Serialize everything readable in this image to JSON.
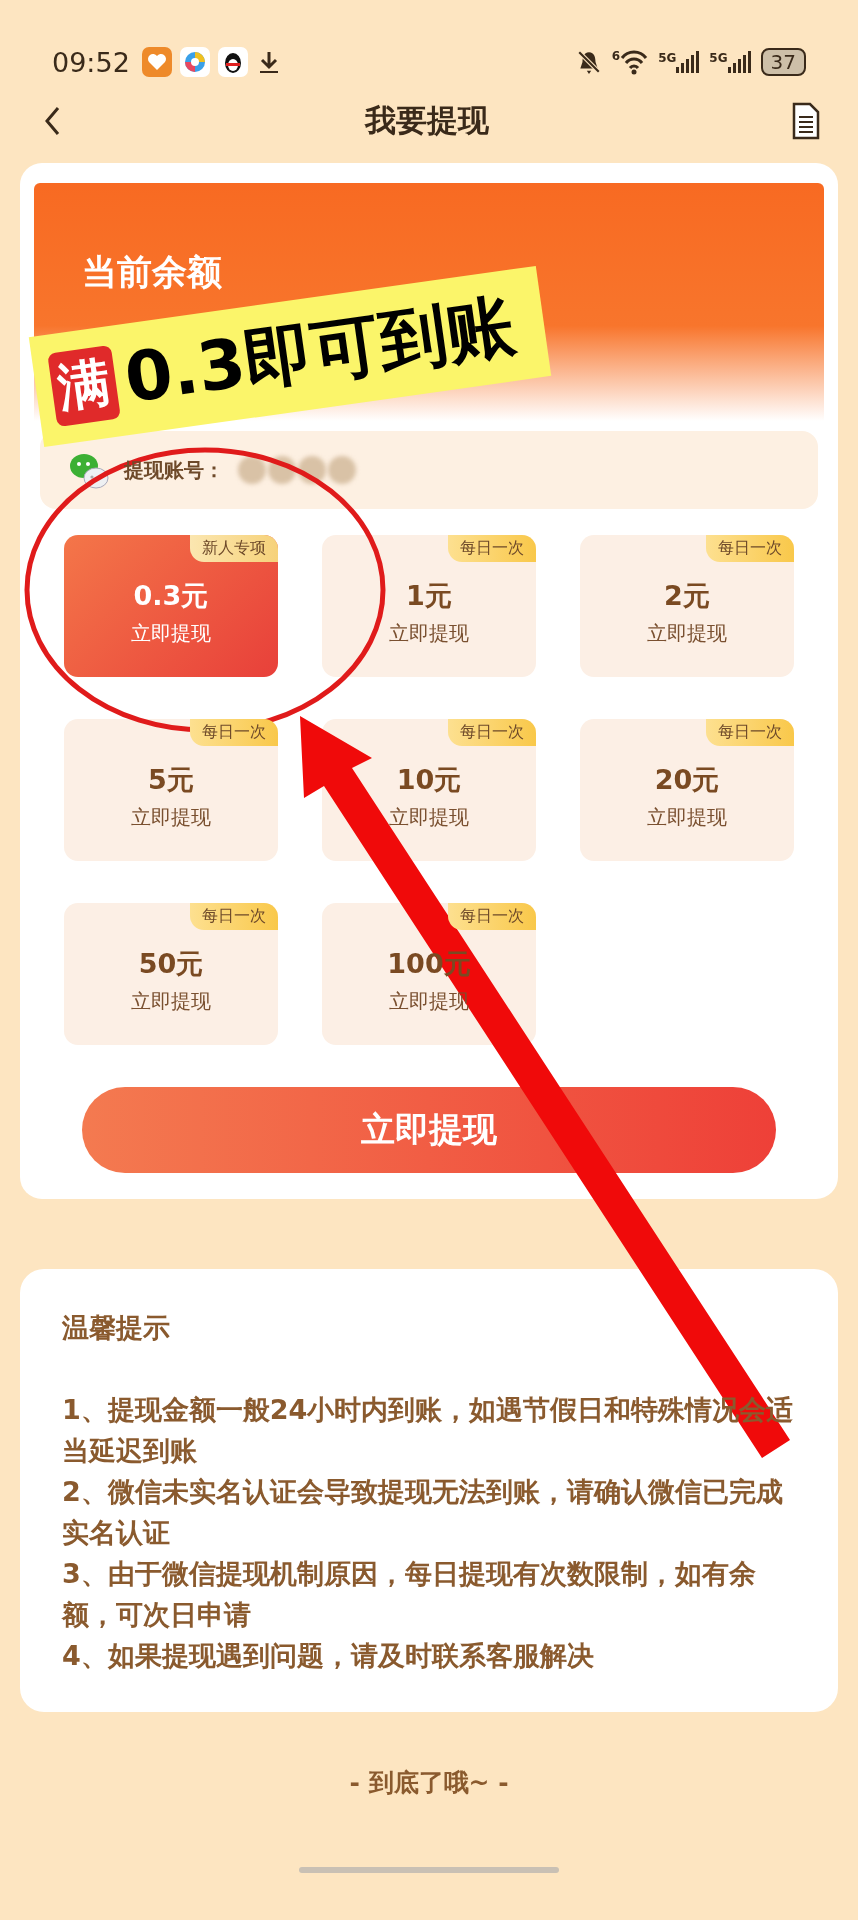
{
  "status_bar": {
    "time": "09:52",
    "wifi_badge": "6",
    "sim_labels": [
      "5G",
      "5G"
    ],
    "battery": "37"
  },
  "header": {
    "title": "我要提现"
  },
  "balance_panel": {
    "label": "当前余额"
  },
  "overlay_banner": {
    "badge": "满",
    "text": "0.3即可到账"
  },
  "account": {
    "label": "提现账号："
  },
  "tiles": [
    {
      "tag": "新人专项",
      "amount": "0.3元",
      "action": "立即提现",
      "selected": true
    },
    {
      "tag": "每日一次",
      "amount": "1元",
      "action": "立即提现",
      "selected": false
    },
    {
      "tag": "每日一次",
      "amount": "2元",
      "action": "立即提现",
      "selected": false
    },
    {
      "tag": "每日一次",
      "amount": "5元",
      "action": "立即提现",
      "selected": false
    },
    {
      "tag": "每日一次",
      "amount": "10元",
      "action": "立即提现",
      "selected": false
    },
    {
      "tag": "每日一次",
      "amount": "20元",
      "action": "立即提现",
      "selected": false
    },
    {
      "tag": "每日一次",
      "amount": "50元",
      "action": "立即提现",
      "selected": false
    },
    {
      "tag": "每日一次",
      "amount": "100元",
      "action": "立即提现",
      "selected": false
    }
  ],
  "withdraw_button": "立即提现",
  "tips": {
    "title": "温馨提示",
    "items": [
      "1、提现金额一般24小时内到账，如遇节假日和特殊情况会适当延迟到账",
      "2、微信未实名认证会导致提现无法到账，请确认微信已完成实名认证",
      "3、由于微信提现机制原因，每日提现有次数限制，如有余额，可次日申请",
      "4、如果提现遇到问题，请及时联系客服解决"
    ]
  },
  "footer": "- 到底了哦~ -"
}
